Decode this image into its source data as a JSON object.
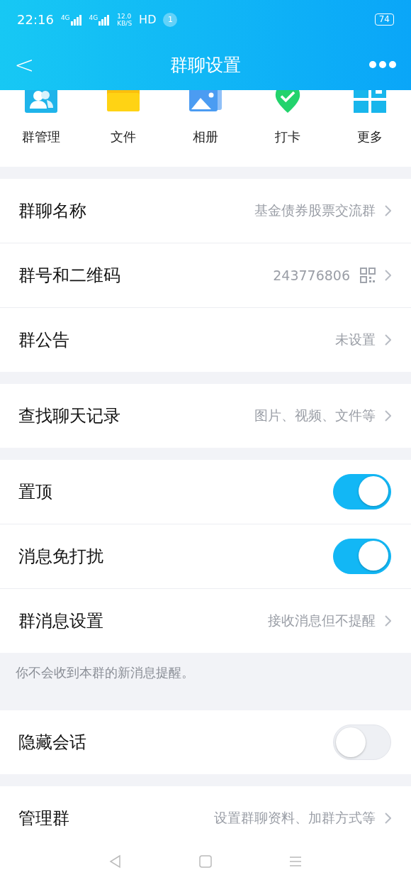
{
  "status_bar": {
    "time": "22:16",
    "signals": [
      {
        "label": "4G"
      },
      {
        "label": "4G"
      }
    ],
    "speed": "12.0",
    "speed_unit": "KB/S",
    "hd": "HD",
    "notification": "1",
    "battery": "74"
  },
  "header": {
    "back": "<",
    "title": "群聊设置"
  },
  "shortcuts": [
    {
      "kind": "people",
      "label": "群管理"
    },
    {
      "kind": "folder",
      "label": "文件"
    },
    {
      "kind": "album",
      "label": "相册"
    },
    {
      "kind": "checkin",
      "label": "打卡"
    },
    {
      "kind": "more",
      "label": "更多"
    }
  ],
  "sections": [
    {
      "rows": [
        {
          "kind": "link",
          "label": "群聊名称",
          "value": "基金债券股票交流群"
        },
        {
          "kind": "qr",
          "label": "群号和二维码",
          "value": "243776806"
        },
        {
          "kind": "link",
          "label": "群公告",
          "value": "未设置"
        }
      ]
    },
    {
      "rows": [
        {
          "kind": "link",
          "label": "查找聊天记录",
          "value": "图片、视频、文件等"
        }
      ]
    },
    {
      "rows": [
        {
          "kind": "toggle",
          "label": "置顶",
          "on": true
        },
        {
          "kind": "toggle",
          "label": "消息免打扰",
          "on": true
        },
        {
          "kind": "link",
          "label": "群消息设置",
          "value": "接收消息但不提醒"
        }
      ],
      "note": "你不会收到本群的新消息提醒。"
    },
    {
      "rows": [
        {
          "kind": "toggle",
          "label": "隐藏会话",
          "on": false
        }
      ]
    },
    {
      "rows": [
        {
          "kind": "link",
          "label": "管理群",
          "value": "设置群聊资料、加群方式等"
        }
      ]
    }
  ]
}
